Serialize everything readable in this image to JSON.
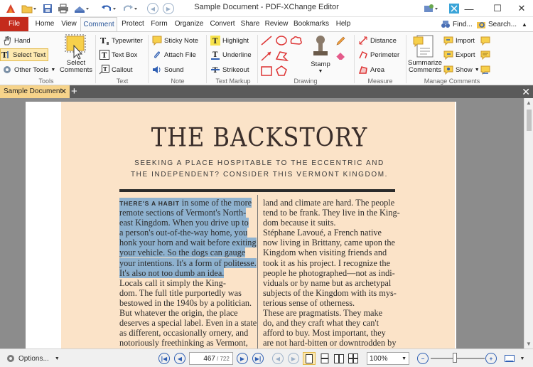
{
  "window": {
    "title": "Sample Document - PDF-XChange Editor",
    "minimize_symbol": "—",
    "maximize_symbol": "☐",
    "close_symbol": "✕"
  },
  "ribbon_tabs": [
    "File",
    "Home",
    "View",
    "Comment",
    "Protect",
    "Form",
    "Organize",
    "Convert",
    "Share",
    "Review",
    "Bookmarks",
    "Help"
  ],
  "active_tab": "Comment",
  "ribbon_right": {
    "find": "Find...",
    "search": "Search..."
  },
  "groups": {
    "tools": {
      "label": "Tools",
      "hand": "Hand",
      "select_text": "Select Text",
      "other_tools": "Other Tools",
      "select_comments_line1": "Select",
      "select_comments_line2": "Comments"
    },
    "text": {
      "label": "Text",
      "typewriter": "Typewriter",
      "text_box": "Text Box",
      "callout": "Callout"
    },
    "note": {
      "label": "Note",
      "sticky_note": "Sticky Note",
      "attach_file": "Attach File",
      "sound": "Sound"
    },
    "text_markup": {
      "label": "Text Markup",
      "highlight": "Highlight",
      "underline": "Underline",
      "strikeout": "Strikeout"
    },
    "drawing": {
      "label": "Drawing",
      "stamp": "Stamp"
    },
    "measure": {
      "label": "Measure",
      "distance": "Distance",
      "perimeter": "Perimeter",
      "area": "Area"
    },
    "manage": {
      "label": "Manage Comments",
      "summarize_line1": "Summarize",
      "summarize_line2": "Comments",
      "import": "Import",
      "export": "Export",
      "show": "Show"
    }
  },
  "document_tab": {
    "name": "Sample Document",
    "close": "✕",
    "new_tab": "+"
  },
  "document_close": "✕",
  "article": {
    "headline": "THE BACKSTORY",
    "subhead_line1": "SEEKING A PLACE HOSPITABLE TO THE ECCENTRIC AND",
    "subhead_line2": "THE INDEPENDENT? CONSIDER THIS VERMONT KINGDOM.",
    "lead_in": "THERE'S A HABIT",
    "left_column": [
      " in some of the more",
      "remote sections of Vermont's North-",
      "east Kingdom. When you drive up to",
      "a person's out-of-the-way home, you",
      "honk your horn and wait before exiting",
      "your vehicle. So the dogs can gauge",
      "your intentions. It's a form of politesse.",
      "It's also not too dumb an idea.",
      "    Locals call it simply the King-",
      "dom. The full title purportedly was",
      "bestowed in the 1940s by a politician.",
      "But whatever the origin, the place",
      "deserves a special label. Even in a state",
      "as different, occasionally ornery, and",
      "notoriously freethinking as Vermont,"
    ],
    "right_column": [
      "land and climate are hard. The people",
      "tend to be frank. They live in the King-",
      "dom because it suits.",
      "    Stéphane Lavoué, a French native",
      "now living in Brittany, came upon the",
      "Kingdom when visiting friends and",
      "took it as his project. I recognize the",
      "people he photographed—not as indi-",
      "viduals or by name but as archetypal",
      "subjects of the Kingdom with its mys-",
      "terious sense of otherness.",
      "    These are pragmatists. They make",
      "do, and they craft what they can't",
      "afford to buy. Most important, they",
      "are not hard-bitten or downtrodden by"
    ],
    "highlighted_lines": 8
  },
  "statusbar": {
    "options": "Options...",
    "current_page": "467",
    "total_pages": "/ 722",
    "zoom": "100%",
    "zoom_fraction": 0.45
  },
  "colors": {
    "file_tab": "#c42b1c",
    "active_tab_text": "#2b579a",
    "highlight": "#8fb2cf",
    "page_tint": "#fbe3c8",
    "doc_tab": "#f6d38a"
  }
}
